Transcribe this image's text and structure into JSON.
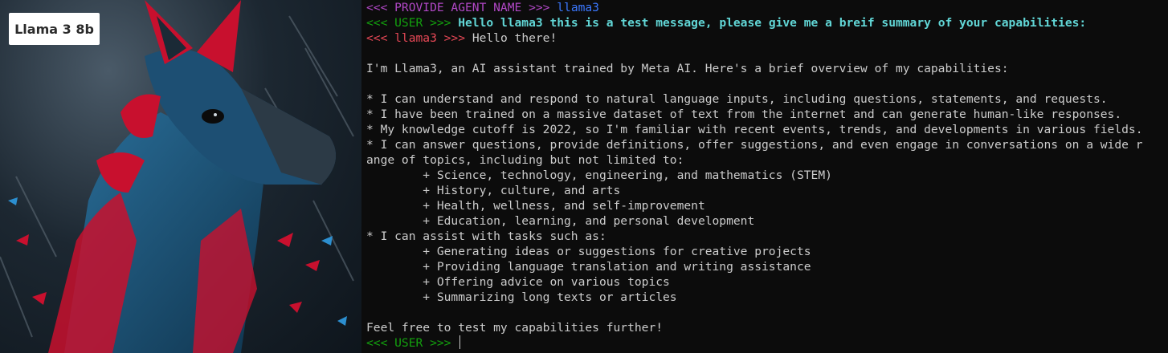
{
  "badge": {
    "label": "Llama 3 8b"
  },
  "colors": {
    "terminal_bg": "#0c0c0c",
    "prompt_magenta": "#b148c6",
    "prompt_green": "#13a10e",
    "prompt_red": "#e74856",
    "agent_name_blue": "#3b78ff",
    "user_msg_cyan": "#61d6d6",
    "text": "#cccccc"
  },
  "terminal": {
    "agent_prompt": "<<< PROVIDE AGENT NAME >>>",
    "agent_name": "llama3",
    "user_prompt": "<<< USER >>>",
    "user_message": "Hello llama3 this is a test message, please give me a breif summary of your capabilities:",
    "llm_prompt": "<<< llama3 >>>",
    "response_first": "Hello there!",
    "response_lines": [
      "",
      "I'm Llama3, an AI assistant trained by Meta AI. Here's a brief overview of my capabilities:",
      "",
      "* I can understand and respond to natural language inputs, including questions, statements, and requests.",
      "* I have been trained on a massive dataset of text from the internet and can generate human-like responses.",
      "* My knowledge cutoff is 2022, so I'm familiar with recent events, trends, and developments in various fields.",
      "* I can answer questions, provide definitions, offer suggestions, and even engage in conversations on a wide r",
      "ange of topics, including but not limited to:",
      "        + Science, technology, engineering, and mathematics (STEM)",
      "        + History, culture, and arts",
      "        + Health, wellness, and self-improvement",
      "        + Education, learning, and personal development",
      "* I can assist with tasks such as:",
      "        + Generating ideas or suggestions for creative projects",
      "        + Providing language translation and writing assistance",
      "        + Offering advice on various topics",
      "        + Summarizing long texts or articles",
      "",
      "Feel free to test my capabilities further!"
    ],
    "final_prompt": "<<< USER >>>"
  }
}
